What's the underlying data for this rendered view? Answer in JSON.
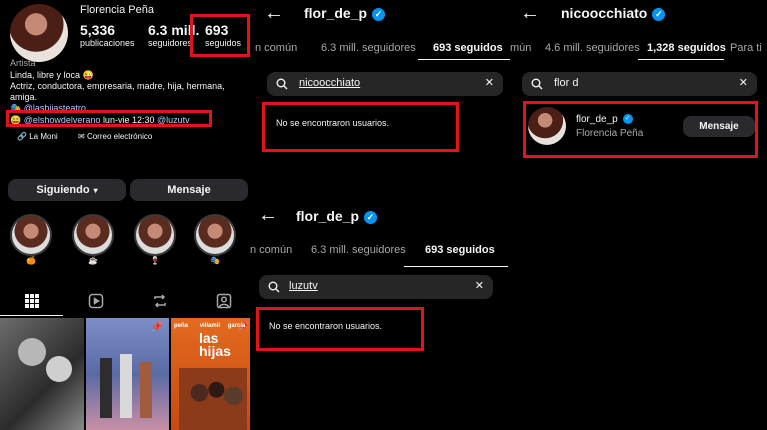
{
  "profile": {
    "name": "Florencia Peña",
    "posts_count": "5,336",
    "posts_label": "publicaciones",
    "followers_count": "6.3 mill.",
    "followers_label": "seguidores",
    "following_count": "693",
    "following_label": "seguidos",
    "category": "Artista",
    "bio_line1": "Linda, libre y loca 😜",
    "bio_line2": "Actriz, conductora, empresaria, madre, hija, hermana,",
    "bio_line3": "amiga.",
    "bio_link1": "@lashijasteatro",
    "bio_emoji2": "😄",
    "bio_link2": "@elshowdelverano",
    "bio_schedule": "lun-vie 12:30",
    "bio_link3": "@luzutv",
    "contact1": "La Moni",
    "contact2": "Correo electrónico",
    "following_button": "Siguiendo",
    "message_button": "Mensaje",
    "highlights": [
      "🍊",
      "☕",
      "🍷",
      "🎭"
    ],
    "grid_tile2_label": "",
    "grid_tile3_title": "LAS\nHIJAS",
    "grid_tile3_names": [
      "peña",
      "villamil",
      "garcía"
    ]
  },
  "panel2": {
    "username": "flor_de_p",
    "tab_common": "n común",
    "tab_followers": "6.3 mill. seguidores",
    "tab_following": "693 seguidos",
    "search_query": "nicoocchiato",
    "empty": "No se encontraron usuarios."
  },
  "panel3": {
    "username": "nicoocchiato",
    "tab_common": "mún",
    "tab_followers": "4.6 mill. seguidores",
    "tab_following": "1,328 seguidos",
    "tab_more": "Para ti",
    "search_query": "flor d",
    "result_username": "flor_de_p",
    "result_name": "Florencia Peña",
    "result_button": "Mensaje"
  },
  "panel4": {
    "username": "flor_de_p",
    "tab_common": "n común",
    "tab_followers": "6.3 mill. seguidores",
    "tab_following": "693 seguidos",
    "search_query": "luzutv",
    "empty": "No se encontraron usuarios."
  },
  "colors": {
    "highlight_box": "#e1141b",
    "verified": "#0095f6",
    "link": "#b9c8ff"
  }
}
